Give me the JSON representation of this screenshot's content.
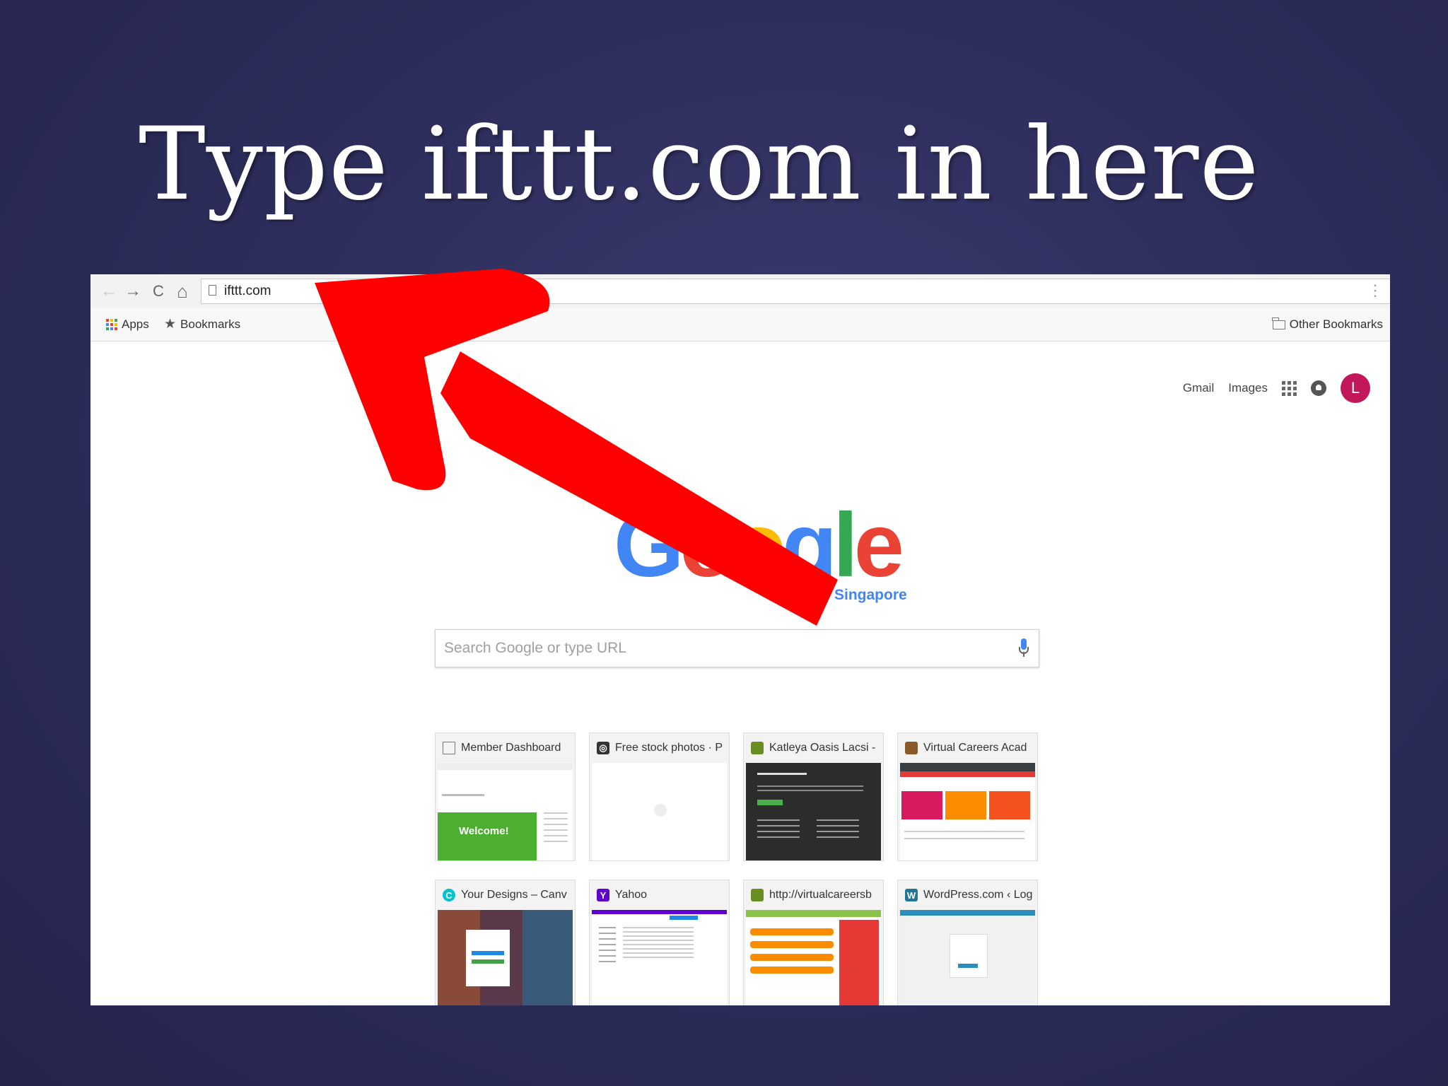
{
  "slide": {
    "title": "Type ifttt.com in here"
  },
  "browser": {
    "nav": {
      "back_icon": "←",
      "forward_icon": "→",
      "reload_icon": "C",
      "home_icon": "⌂"
    },
    "address_bar": {
      "value": "ifttt.com"
    },
    "bookmarks_bar": {
      "apps_label": "Apps",
      "bookmarks_label": "Bookmarks",
      "other_bookmarks_label": "Other Bookmarks"
    },
    "ntp": {
      "top_links": {
        "gmail": "Gmail",
        "images": "Images",
        "avatar_letter": "L"
      },
      "logo": "Google",
      "logo_sub": "Singapore",
      "search": {
        "placeholder": "Search Google or type URL"
      },
      "tiles": [
        {
          "title": "Member Dashboard",
          "icon": "page-icon"
        },
        {
          "title": "Free stock photos · P",
          "icon": "camera-icon"
        },
        {
          "title": "Katleya Oasis Lacsi -",
          "icon": "site-icon"
        },
        {
          "title": "Virtual Careers Acad",
          "icon": "site-icon"
        },
        {
          "title": "Your Designs – Canv",
          "icon": "canva-icon"
        },
        {
          "title": "Yahoo",
          "icon": "yahoo-icon"
        },
        {
          "title": "http://virtualcareersb",
          "icon": "site-icon"
        },
        {
          "title": "WordPress.com ‹ Log",
          "icon": "wordpress-icon"
        }
      ],
      "welcome_text": "Welcome!"
    }
  },
  "colors": {
    "arrow": "#ff0000",
    "background": "#2c2c5a",
    "avatar": "#c2185b",
    "google_blue": "#4285f4",
    "google_red": "#ea4335",
    "google_yellow": "#fbbc05",
    "google_green": "#34a853"
  }
}
